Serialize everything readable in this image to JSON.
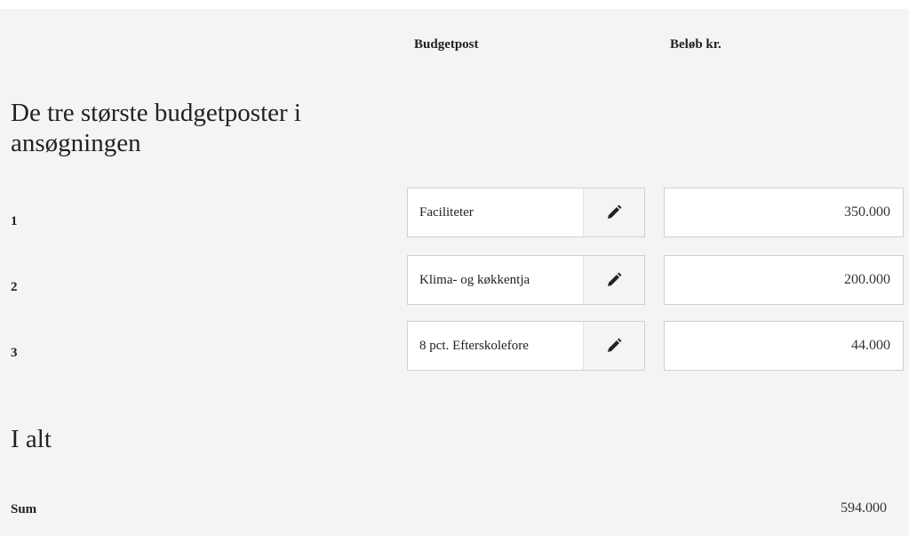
{
  "headers": {
    "budgetpost": "Budgetpost",
    "belob": "Beløb kr."
  },
  "section_title": "De tre største budgetposter i ansøgningen",
  "rows": [
    {
      "number": "1",
      "name": "Faciliteter",
      "amount": "350.000"
    },
    {
      "number": "2",
      "name": "Klima- og køkkentja",
      "amount": "200.000"
    },
    {
      "number": "3",
      "name": "8 pct. Efterskolefore",
      "amount": "44.000"
    }
  ],
  "total": {
    "title": "I alt",
    "label": "Sum",
    "value": "594.000"
  },
  "icons": {
    "edit": "pencil-icon"
  },
  "colors": {
    "panel_bg": "#f4f4f4",
    "field_border": "#cfcfcf",
    "text": "#222222"
  }
}
